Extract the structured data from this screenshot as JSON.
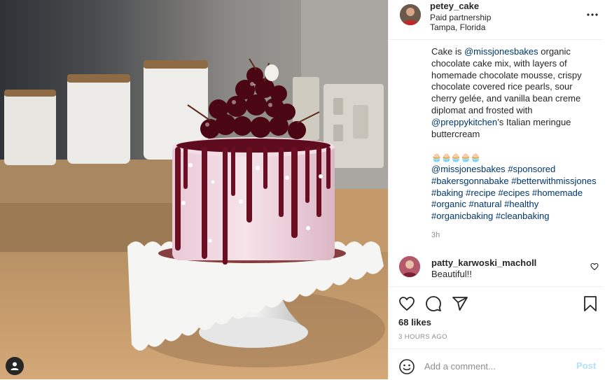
{
  "post": {
    "username": "petey_cake",
    "subtitle": "Paid partnership",
    "location": "Tampa, Florida",
    "more_icon": "more-options-icon"
  },
  "caption": {
    "t1": "Cake is ",
    "m1": "@missjonesbakes",
    "t2": " organic chocolate cake mix, with layers of homemade chocolate mousse, crispy chocolate covered rice pearls, sour cherry gelée, and vanilla bean creme diplomat and frosted with ",
    "m2": "@preppykitchen",
    "t3": "’s Italian meringue buttercream",
    "emoji": "🧁🧁🧁🧁🧁",
    "tags": [
      "@missjonesbakes",
      "#sponsored",
      "#bakersgonnabake",
      "#betterwithmissjones",
      "#baking",
      "#recipe",
      "#ecipes",
      "#homemade",
      "#organic",
      "#natural",
      "#healthy",
      "#organicbaking",
      "#cleanbaking"
    ],
    "time": "3h"
  },
  "comment": {
    "user": "patty_karwoski_macholl",
    "text": "Beautiful!!"
  },
  "actions": {
    "like_icon": "heart-icon",
    "comment_icon": "comment-icon",
    "share_icon": "share-icon",
    "save_icon": "bookmark-icon"
  },
  "likes": "68 likes",
  "posted_ago": "3 HOURS AGO",
  "add_comment": {
    "placeholder": "Add a comment...",
    "post_label": "Post"
  },
  "colors": {
    "link": "#00376b",
    "muted": "#8e8e8e",
    "post_disabled": "#b2dffc",
    "frosting": "#f3dce6",
    "cherry_glaze": "#6a0f22"
  }
}
